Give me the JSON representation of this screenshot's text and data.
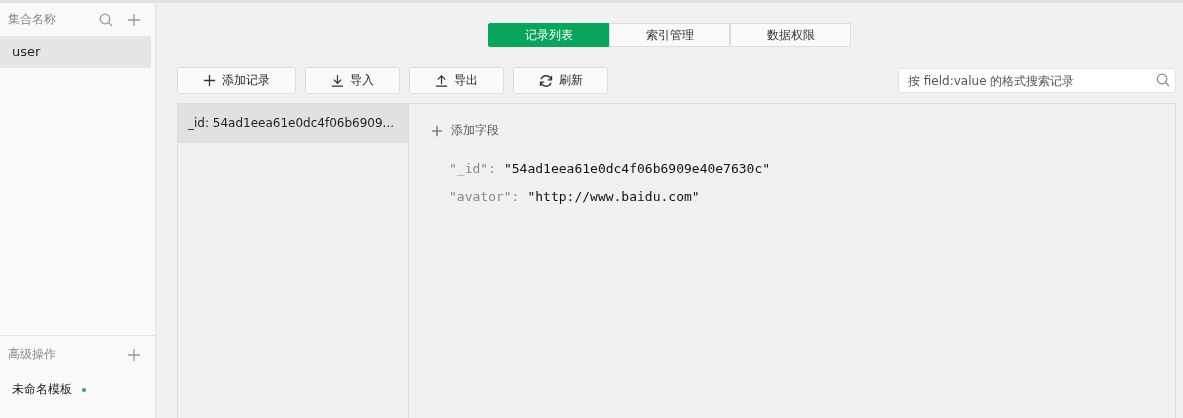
{
  "sidebar": {
    "title": "集合名称",
    "collections": [
      {
        "name": "user",
        "selected": true
      }
    ],
    "advanced_title": "高级操作",
    "templates": [
      {
        "name": "未命名模板",
        "color": "#2ba471"
      }
    ]
  },
  "tabs": [
    {
      "label": "记录列表",
      "selected": true
    },
    {
      "label": "索引管理",
      "selected": false
    },
    {
      "label": "数据权限",
      "selected": false
    }
  ],
  "toolbar": [
    {
      "kind": "add",
      "label": "添加记录"
    },
    {
      "kind": "import",
      "label": "导入"
    },
    {
      "kind": "export",
      "label": "导出"
    },
    {
      "kind": "refresh",
      "label": "刷新"
    }
  ],
  "search": {
    "placeholder": "按 field:value 的格式搜索记录"
  },
  "records": [
    {
      "label": "_id: 54ad1eea61e0dc4f06b6909...",
      "selected": true
    }
  ],
  "detail": {
    "add_field": "添加字段",
    "fields": [
      {
        "key": "\"_id\":",
        "value": "\"54ad1eea61e0dc4f06b6909e40e7630c\""
      },
      {
        "key": "\"avator\":",
        "value": "\"http://www.baidu.com\""
      }
    ]
  }
}
